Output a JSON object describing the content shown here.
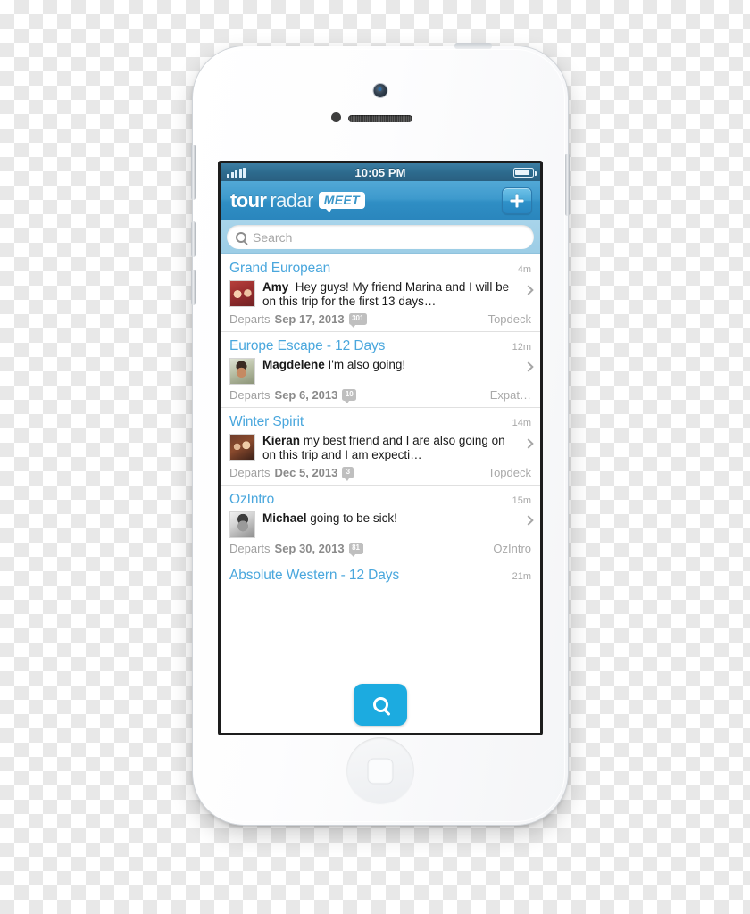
{
  "device": {
    "name": "iphone-5-white"
  },
  "status_bar": {
    "time": "10:05 PM",
    "signal_bars": 5,
    "battery_level": "88%"
  },
  "navbar": {
    "logo_part1": "tour",
    "logo_part2": "radar",
    "logo_badge": "MEET",
    "add_button_label": "+"
  },
  "search": {
    "placeholder": "Search",
    "value": ""
  },
  "fab": {
    "icon": "search-icon"
  },
  "list": {
    "items": [
      {
        "title": "Grand European",
        "time": "4m",
        "author": "Amy",
        "message": "Hey guys! My friend Marina and I will be on this trip for the first 13 days…",
        "departs_label": "Departs",
        "departs_date": "Sep 17, 2013",
        "badge": "301",
        "operator": "Topdeck",
        "avatar": "amy-avatar"
      },
      {
        "title": "Europe Escape - 12 Days",
        "time": "12m",
        "author": "Magdelene",
        "message": "I'm also going!",
        "departs_label": "Departs",
        "departs_date": "Sep 6, 2013",
        "badge": "10",
        "operator": "Expat…",
        "avatar": "magdelene-avatar"
      },
      {
        "title": "Winter Spirit",
        "time": "14m",
        "author": "Kieran",
        "message": "my best friend and I are also going on on this trip and I am expecti…",
        "departs_label": "Departs",
        "departs_date": "Dec 5, 2013",
        "badge": "3",
        "operator": "Topdeck",
        "avatar": "kieran-avatar"
      },
      {
        "title": "OzIntro",
        "time": "15m",
        "author": "Michael",
        "message": "going to be sick!",
        "departs_label": "Departs",
        "departs_date": "Sep 30, 2013",
        "badge": "81",
        "operator": "OzIntro",
        "avatar": "michael-avatar"
      }
    ],
    "partial_item": {
      "title": "Absolute Western - 12 Days",
      "time": "21m"
    }
  },
  "colors": {
    "nav_blue": "#3e9acd",
    "title_blue": "#4aa7dd",
    "fab_cyan": "#1cabe0",
    "search_band": "#a8d4ea"
  }
}
